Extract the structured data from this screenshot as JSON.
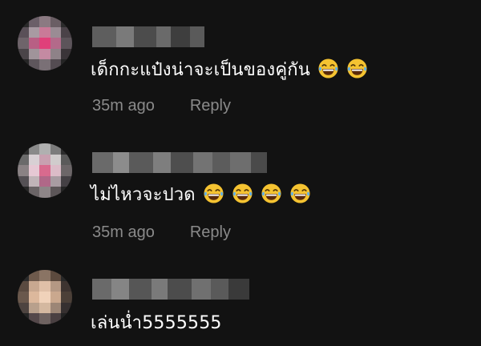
{
  "comments": [
    {
      "text": "เด็กกะแป๋งน่าจะเป็นของคู่กัน",
      "emojis": [
        "laughing-with-tears",
        "laughing-with-tears"
      ],
      "time": "35m ago",
      "reply_label": "Reply"
    },
    {
      "text": "ไม่ไหวจะปวด",
      "emojis": [
        "laughing-with-tears",
        "laughing-with-tears",
        "laughing-with-tears",
        "laughing-with-tears"
      ],
      "time": "35m ago",
      "reply_label": "Reply"
    },
    {
      "text": "เล่นน่ำ5555555",
      "emojis": []
    }
  ],
  "colors": {
    "background": "#121212",
    "text": "#ffffff",
    "meta": "#8a8a8a"
  }
}
